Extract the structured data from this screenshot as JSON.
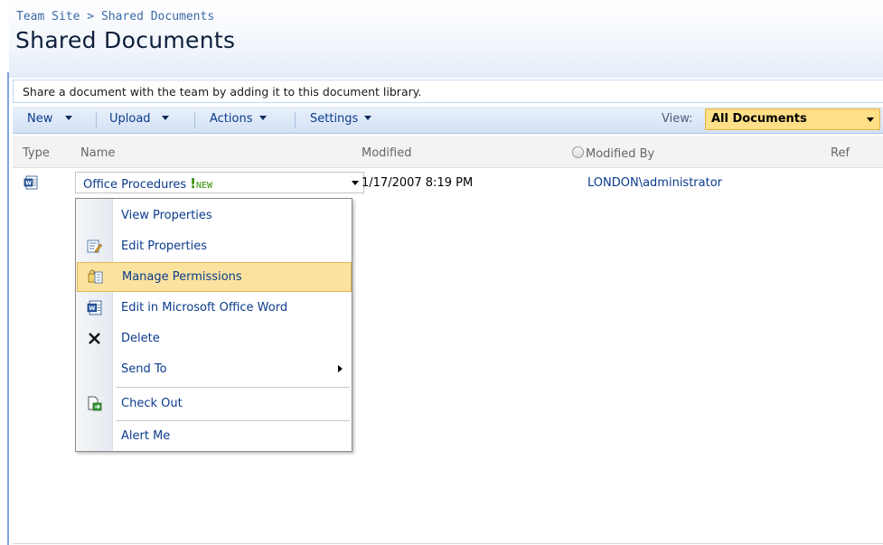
{
  "header": {
    "breadcrumb_site": "Team Site",
    "breadcrumb_sep": ">",
    "breadcrumb_current": "Shared Documents",
    "title": "Shared Documents"
  },
  "description": "Share a document with the team by adding it to this document library.",
  "toolbar": {
    "new_label": "New",
    "upload_label": "Upload",
    "actions_label": "Actions",
    "settings_label": "Settings",
    "view_label": "View:",
    "view_value": "All Documents"
  },
  "columns": {
    "type": "Type",
    "name": "Name",
    "modified": "Modified",
    "modified_by": "Modified By",
    "ref": "Ref"
  },
  "rows": [
    {
      "icon": "word-document-icon",
      "name": "Office Procedures",
      "new_marker": "!",
      "new_text": "NEW",
      "modified": "1/17/2007 8:19 PM",
      "modified_by": "LONDON\\administrator"
    }
  ],
  "context_menu": {
    "items": [
      {
        "label": "View Properties",
        "icon": ""
      },
      {
        "label": "Edit Properties",
        "icon": "edit-properties-icon"
      },
      {
        "label": "Manage Permissions",
        "icon": "manage-permissions-icon",
        "highlighted": true
      },
      {
        "label": "Edit in Microsoft Office Word",
        "icon": "word-document-icon"
      },
      {
        "label": "Delete",
        "icon": "delete-icon"
      },
      {
        "label": "Send To",
        "icon": "",
        "has_submenu": true
      },
      {
        "label": "Check Out",
        "icon": "check-out-icon"
      },
      {
        "label": "Alert Me",
        "icon": ""
      }
    ]
  },
  "colors": {
    "link": "#0b3b8c",
    "new_marker": "#2f8f00",
    "highlight": "#fbe39f",
    "view_select": "#ffdf88"
  }
}
